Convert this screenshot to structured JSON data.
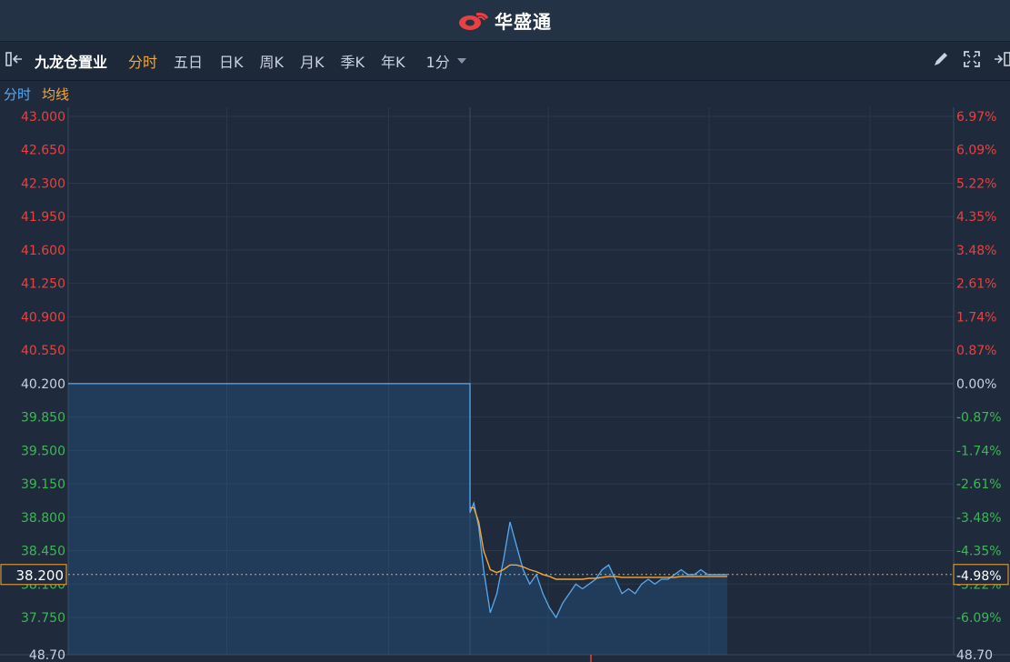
{
  "header": {
    "brand": "华盛通",
    "logo_icon": "huashengtong-logo-icon"
  },
  "toolbar": {
    "stock_name": "九龙仓置业",
    "tabs": [
      {
        "label": "分时",
        "active": true
      },
      {
        "label": "五日",
        "active": false
      },
      {
        "label": "日K",
        "active": false
      },
      {
        "label": "周K",
        "active": false
      },
      {
        "label": "月K",
        "active": false
      },
      {
        "label": "季K",
        "active": false
      },
      {
        "label": "年K",
        "active": false
      }
    ],
    "interval": "1分",
    "icons": [
      "collapse-left-icon",
      "pencil-icon",
      "fullscreen-icon",
      "expand-right-icon"
    ]
  },
  "legend": {
    "minute_label": "分时",
    "average_label": "均线"
  },
  "colors": {
    "price_line": "#5aa9ee",
    "average_line": "#f3a73c",
    "up": "#e8413f",
    "down": "#3cb754",
    "neutral": "#c9d2de"
  },
  "chart_data": {
    "type": "line",
    "prev_close": 40.2,
    "current_price": "38.200",
    "current_change": "-4.98%",
    "y_ticks": [
      "43.000",
      "42.650",
      "42.300",
      "41.950",
      "41.600",
      "41.250",
      "40.900",
      "40.550",
      "40.200",
      "39.850",
      "39.500",
      "39.150",
      "38.800",
      "38.450",
      "38.100",
      "37.750"
    ],
    "y_tick_values": [
      43.0,
      42.65,
      42.3,
      41.95,
      41.6,
      41.25,
      40.9,
      40.55,
      40.2,
      39.85,
      39.5,
      39.15,
      38.8,
      38.45,
      38.1,
      37.75
    ],
    "pct_ticks": [
      "6.97%",
      "6.09%",
      "5.22%",
      "4.35%",
      "3.48%",
      "2.61%",
      "1.74%",
      "0.87%",
      "0.00%",
      "-0.87%",
      "-1.74%",
      "-2.61%",
      "-3.48%",
      "-4.35%",
      "-5.22%",
      "-6.09%"
    ],
    "bottom_left_label": "48.70",
    "bottom_right_label": "48.70",
    "x_session_fraction": [
      0,
      0.0185,
      0.03,
      0.045,
      0.06,
      0.08,
      0.1,
      0.12,
      0.14,
      0.16,
      0.18,
      0.2,
      0.22,
      0.24,
      0.26,
      0.28,
      0.3,
      0.32,
      0.34,
      0.36,
      0.38,
      0.4,
      0.42,
      0.44,
      0.46,
      0.48,
      0.5,
      0.52,
      0.54,
      0.56,
      0.58,
      0.6,
      0.62,
      0.64,
      0.66,
      0.68,
      0.7,
      0.72,
      0.74,
      0.76,
      0.78,
      0.8
    ],
    "price_series": [
      40.2,
      38.85,
      38.95,
      38.7,
      38.25,
      37.8,
      38.0,
      38.35,
      38.75,
      38.5,
      38.25,
      38.1,
      38.2,
      38.0,
      37.85,
      37.75,
      37.9,
      38.0,
      38.1,
      38.05,
      38.1,
      38.15,
      38.25,
      38.3,
      38.15,
      38.0,
      38.05,
      38.0,
      38.1,
      38.15,
      38.1,
      38.15,
      38.15,
      38.2,
      38.25,
      38.2,
      38.2,
      38.25,
      38.2,
      38.2,
      38.2,
      38.2
    ],
    "average_series": [
      40.2,
      38.9,
      38.9,
      38.75,
      38.45,
      38.25,
      38.22,
      38.25,
      38.3,
      38.3,
      38.28,
      38.25,
      38.23,
      38.2,
      38.18,
      38.15,
      38.15,
      38.15,
      38.15,
      38.15,
      38.16,
      38.16,
      38.17,
      38.18,
      38.18,
      38.17,
      38.17,
      38.17,
      38.17,
      38.17,
      38.17,
      38.17,
      38.17,
      38.17,
      38.18,
      38.18,
      38.18,
      38.18,
      38.18,
      38.18,
      38.18,
      38.18
    ]
  }
}
